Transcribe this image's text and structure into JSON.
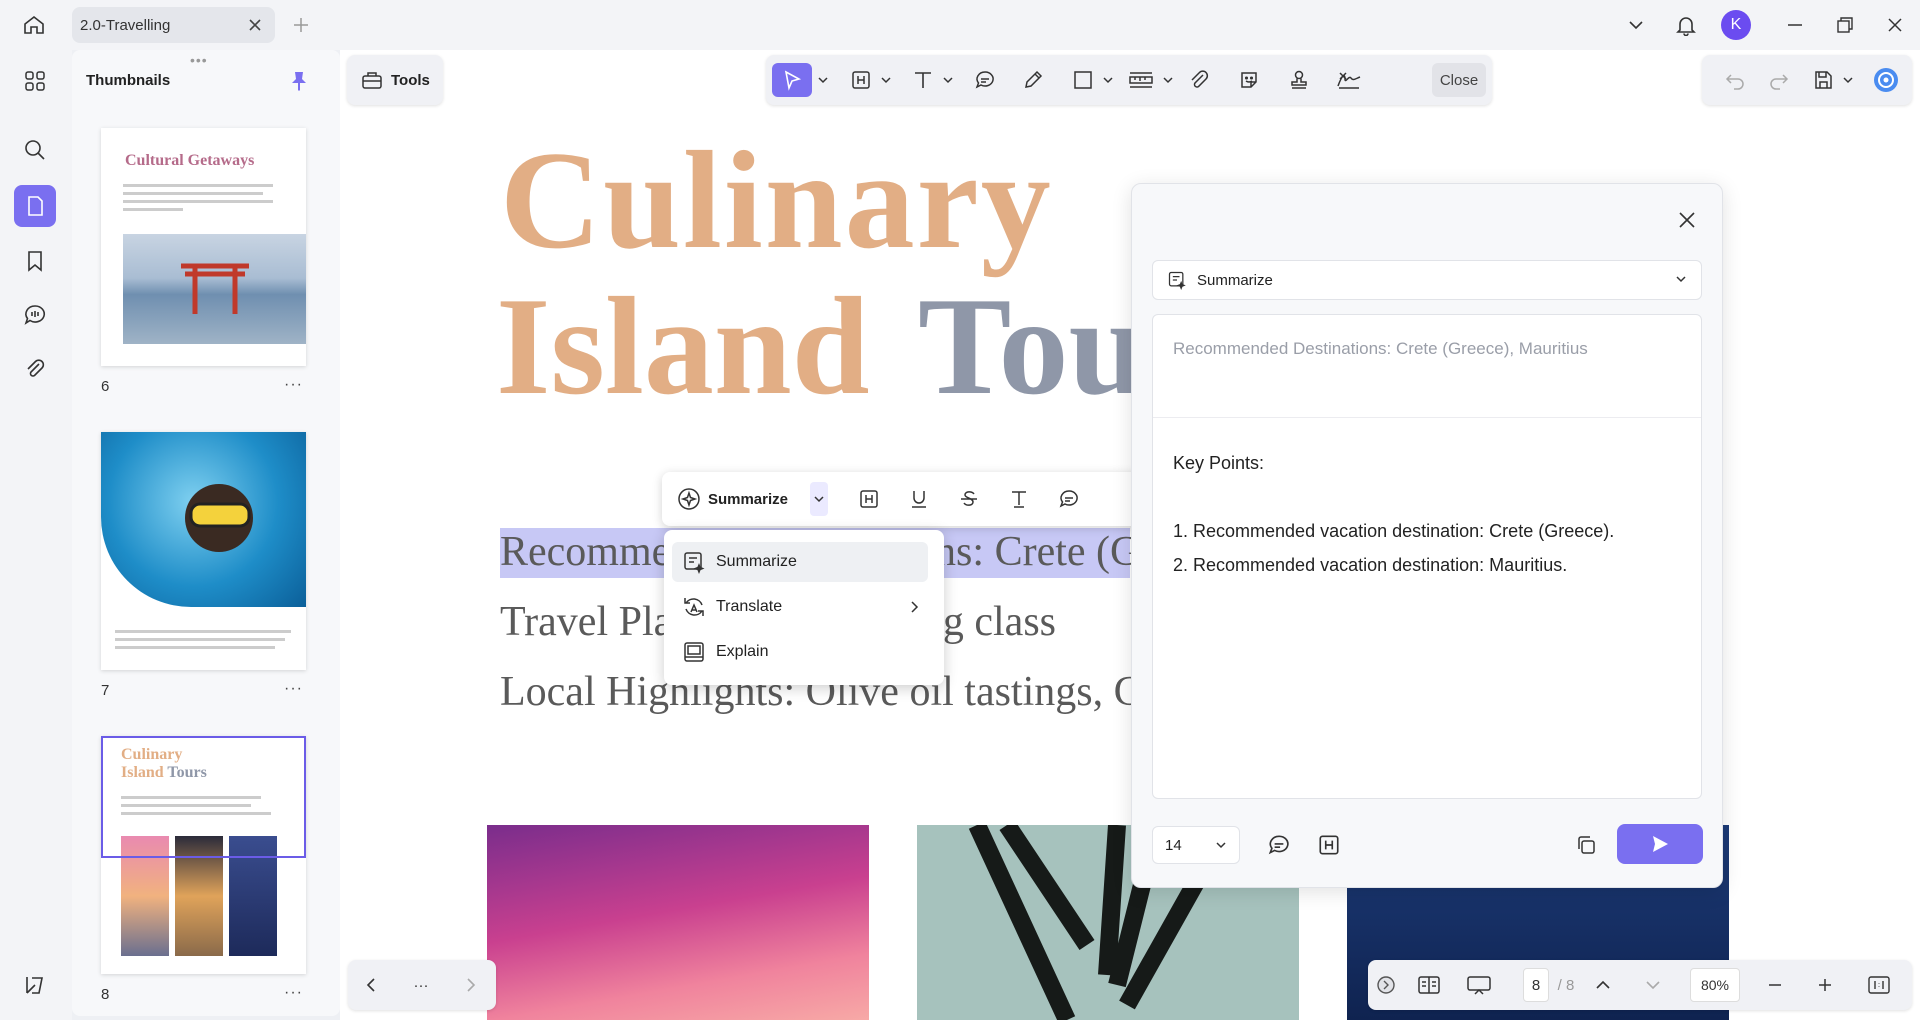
{
  "tab": {
    "title": "2.0-Travelling"
  },
  "user": {
    "initial": "K"
  },
  "thumbnails": {
    "title": "Thumbnails",
    "pages": [
      {
        "number": "6",
        "title": "Cultural Getaways"
      },
      {
        "number": "7"
      },
      {
        "number": "8",
        "title_line1": "Culinary",
        "title_line2a": "Island",
        "title_line2b": "Tours"
      }
    ],
    "more": "···"
  },
  "tools": {
    "label": "Tools"
  },
  "toolbar": {
    "close_label": "Close"
  },
  "document": {
    "title_line1": "Culinary",
    "title_line2a": "Island",
    "title_line2b": "Tou",
    "line1": "Recommended Destinations: Crete (G",
    "line2": "Travel Plan: Greek cooking class",
    "line3": "Local Highlights: Olive oil tastings, C"
  },
  "floating_toolbar": {
    "summarize_label": "Summarize"
  },
  "ai_menu": {
    "items": [
      {
        "label": "Summarize"
      },
      {
        "label": "Translate"
      },
      {
        "label": "Explain"
      }
    ]
  },
  "ai_panel": {
    "mode": "Summarize",
    "source_text": "Recommended Destinations: Crete (Greece), Mauritius",
    "key_points_title": "Key Points:",
    "key_points": [
      "1. Recommended vacation destination: Crete (Greece).",
      "2. Recommended vacation destination: Mauritius."
    ],
    "font_size": "14"
  },
  "bottom_nav": {
    "more": "···"
  },
  "pagination": {
    "current_page": "8",
    "total_pages": "/ 8",
    "zoom": "80%"
  },
  "colors": {
    "accent": "#7a6ff0",
    "title_orange": "#e2ae85",
    "title_gray": "#8f97a8",
    "highlight": "#c7c8f5"
  }
}
